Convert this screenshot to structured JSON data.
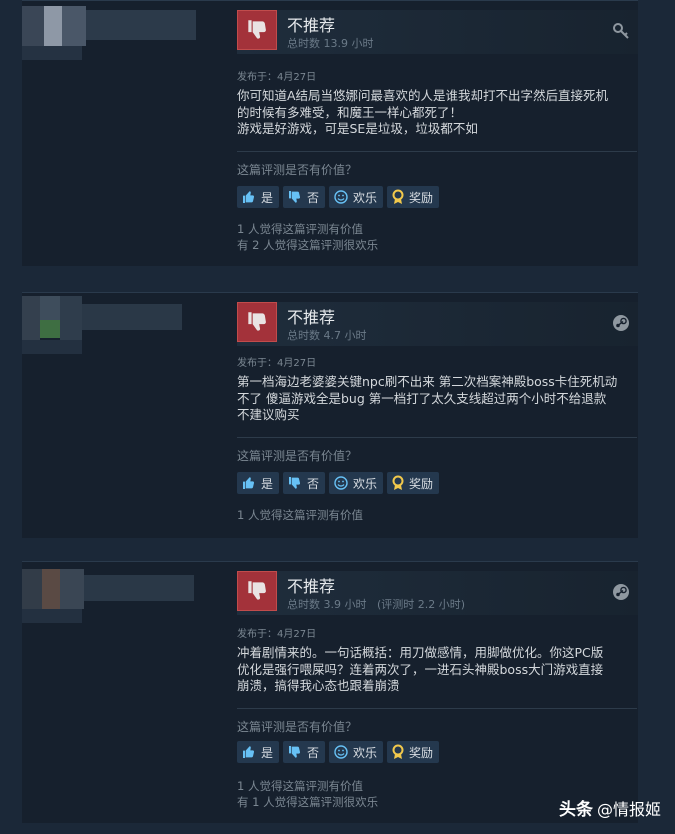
{
  "reviews": [
    {
      "verdict": "不推荐",
      "hours": "总时数 13.9 小时",
      "corner_icon": "key-icon",
      "posted": "发布于：4月27日",
      "content": [
        "你可知道A结局当悠娜问最喜欢的人是谁我却打不出字然后直接死机",
        "的时候有多难受，和魔王一样心都死了！",
        "游戏是好游戏，可是SE是垃圾，垃圾都不如"
      ],
      "ask": "这篇评测是否有价值？",
      "buttons": {
        "yes": "是",
        "no": "否",
        "funny": "欢乐",
        "award": "奖励"
      },
      "stats": [
        "1 人觉得这篇评测有价值",
        "有 2 人觉得这篇评测很欢乐"
      ]
    },
    {
      "verdict": "不推荐",
      "hours": "总时数 4.7 小时",
      "corner_icon": "steam-icon",
      "posted": "发布于：4月27日",
      "content": [
        "第一档海边老婆婆关键npc刷不出来 第二次档案神殿boss卡住死机动",
        "不了 傻逼游戏全是bug 第一档打了太久支线超过两个小时不给退款",
        "不建议购买"
      ],
      "ask": "这篇评测是否有价值？",
      "buttons": {
        "yes": "是",
        "no": "否",
        "funny": "欢乐",
        "award": "奖励"
      },
      "stats": [
        "1 人觉得这篇评测有价值"
      ]
    },
    {
      "verdict": "不推荐",
      "hours": "总时数 3.9 小时   (评测时 2.2 小时)",
      "corner_icon": "steam-icon",
      "posted": "发布于：4月27日",
      "content": [
        "冲着剧情来的。一句话概括：用刀做感情，用脚做优化。你这PC版",
        "优化是强行喂屎吗？连着两次了，一进石头神殿boss大门游戏直接",
        "崩溃，搞得我心态也跟着崩溃"
      ],
      "ask": "这篇评测是否有价值？",
      "buttons": {
        "yes": "是",
        "no": "否",
        "funny": "欢乐",
        "award": "奖励"
      },
      "stats": [
        "1 人觉得这篇评测有价值",
        "有 1 人觉得这篇评测很欢乐"
      ]
    }
  ],
  "watermark": {
    "brand": "头条",
    "handle": "@情报姬"
  },
  "colors": {
    "background": "#1b2838",
    "card": "#16202d",
    "thumb_down": "#a3323a",
    "button": "#24384e"
  }
}
